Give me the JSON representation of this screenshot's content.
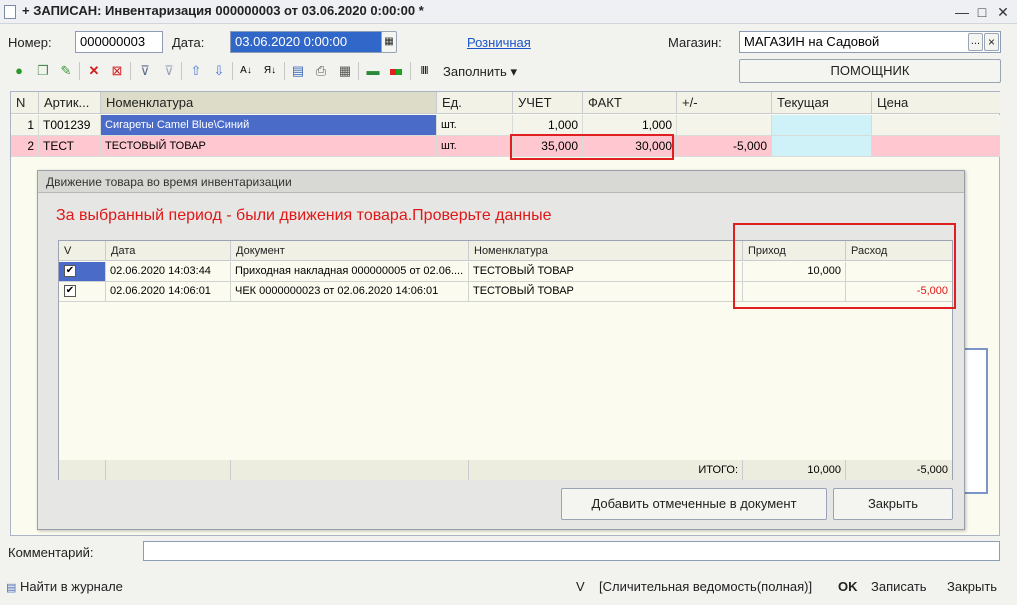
{
  "window": {
    "title": "+ ЗАПИСАН: Инвентаризация 000000003 от 03.06.2020 0:00:00 *",
    "minimize": "—",
    "maximize": "□",
    "close": "✕"
  },
  "header": {
    "number_label": "Номер:",
    "number_value": "000000003",
    "date_label": "Дата:",
    "date_value": "03.06.2020  0:00:00",
    "retail_link": "Розничная",
    "store_label": "Магазин:",
    "store_value": "МАГАЗИН на Садовой",
    "store_select": "...",
    "store_clear": "×",
    "assistant_button": "ПОМОЩНИК"
  },
  "toolbar": {
    "fill_label": "Заполнить",
    "icons": [
      "add-icon",
      "copy-icon",
      "edit-icon",
      "delete-icon",
      "delete-marked-icon",
      "filter-icon",
      "clear-filter-icon",
      "move-up-icon",
      "move-down-icon",
      "sort-asc-icon",
      "sort-desc-icon",
      "properties-icon",
      "print-icon",
      "report-icon",
      "barcode-icon",
      "color-icon",
      "scanner-icon"
    ]
  },
  "table": {
    "columns": [
      "N",
      "Артик...",
      "Номенклатура",
      "Ед.",
      "УЧЕТ",
      "ФАКТ",
      "+/-",
      "Текущая",
      "Цена"
    ],
    "rows": [
      {
        "n": "1",
        "article": "T001239",
        "name": "Сигареты Camel Blue\\Синий",
        "unit": "шт.",
        "accounted": "1,000",
        "actual": "1,000",
        "diff": "",
        "current": "",
        "price": ""
      },
      {
        "n": "2",
        "article": "ТЕСТ",
        "name": "ТЕСТОВЫЙ ТОВАР",
        "unit": "шт.",
        "accounted": "35,000",
        "actual": "30,000",
        "diff": "-5,000",
        "current": "",
        "price": ""
      }
    ]
  },
  "dialog": {
    "title": "Движение товара во время инвентаризации",
    "warning": "За выбранный период - были движения товара.Проверьте данные",
    "columns": [
      "V",
      "Дата",
      "Документ",
      "Номенклатура",
      "Приход",
      "Расход"
    ],
    "rows": [
      {
        "checked": "✔",
        "date": "02.06.2020 14:03:44",
        "document": "Приходная накладная 000000005 от 02.06....",
        "item": "ТЕСТОВЫЙ ТОВАР",
        "income": "10,000",
        "expense": ""
      },
      {
        "checked": "✔",
        "date": "02.06.2020 14:06:01",
        "document": "ЧЕК 0000000023 от 02.06.2020 14:06:01",
        "item": "ТЕСТОВЫЙ ТОВАР",
        "income": "",
        "expense": "-5,000"
      }
    ],
    "total_label": "ИТОГО:",
    "total_income": "10,000",
    "total_expense": "-5,000",
    "add_button": "Добавить отмеченные в документ",
    "close_button": "Закрыть"
  },
  "footer": {
    "comment_label": "Комментарий:",
    "comment_value": "",
    "find_journal": "Найти в журнале",
    "v_label": "V",
    "report_link": "[Сличительная ведомость(полная)]",
    "ok": "OK",
    "save": "Записать",
    "close": "Закрыть"
  },
  "colors": {
    "row_selected": "#4a6cc8",
    "row_pink": "#ffc8d0",
    "highlight_cyan": "#cff2f8",
    "warning_red": "#e01818"
  }
}
